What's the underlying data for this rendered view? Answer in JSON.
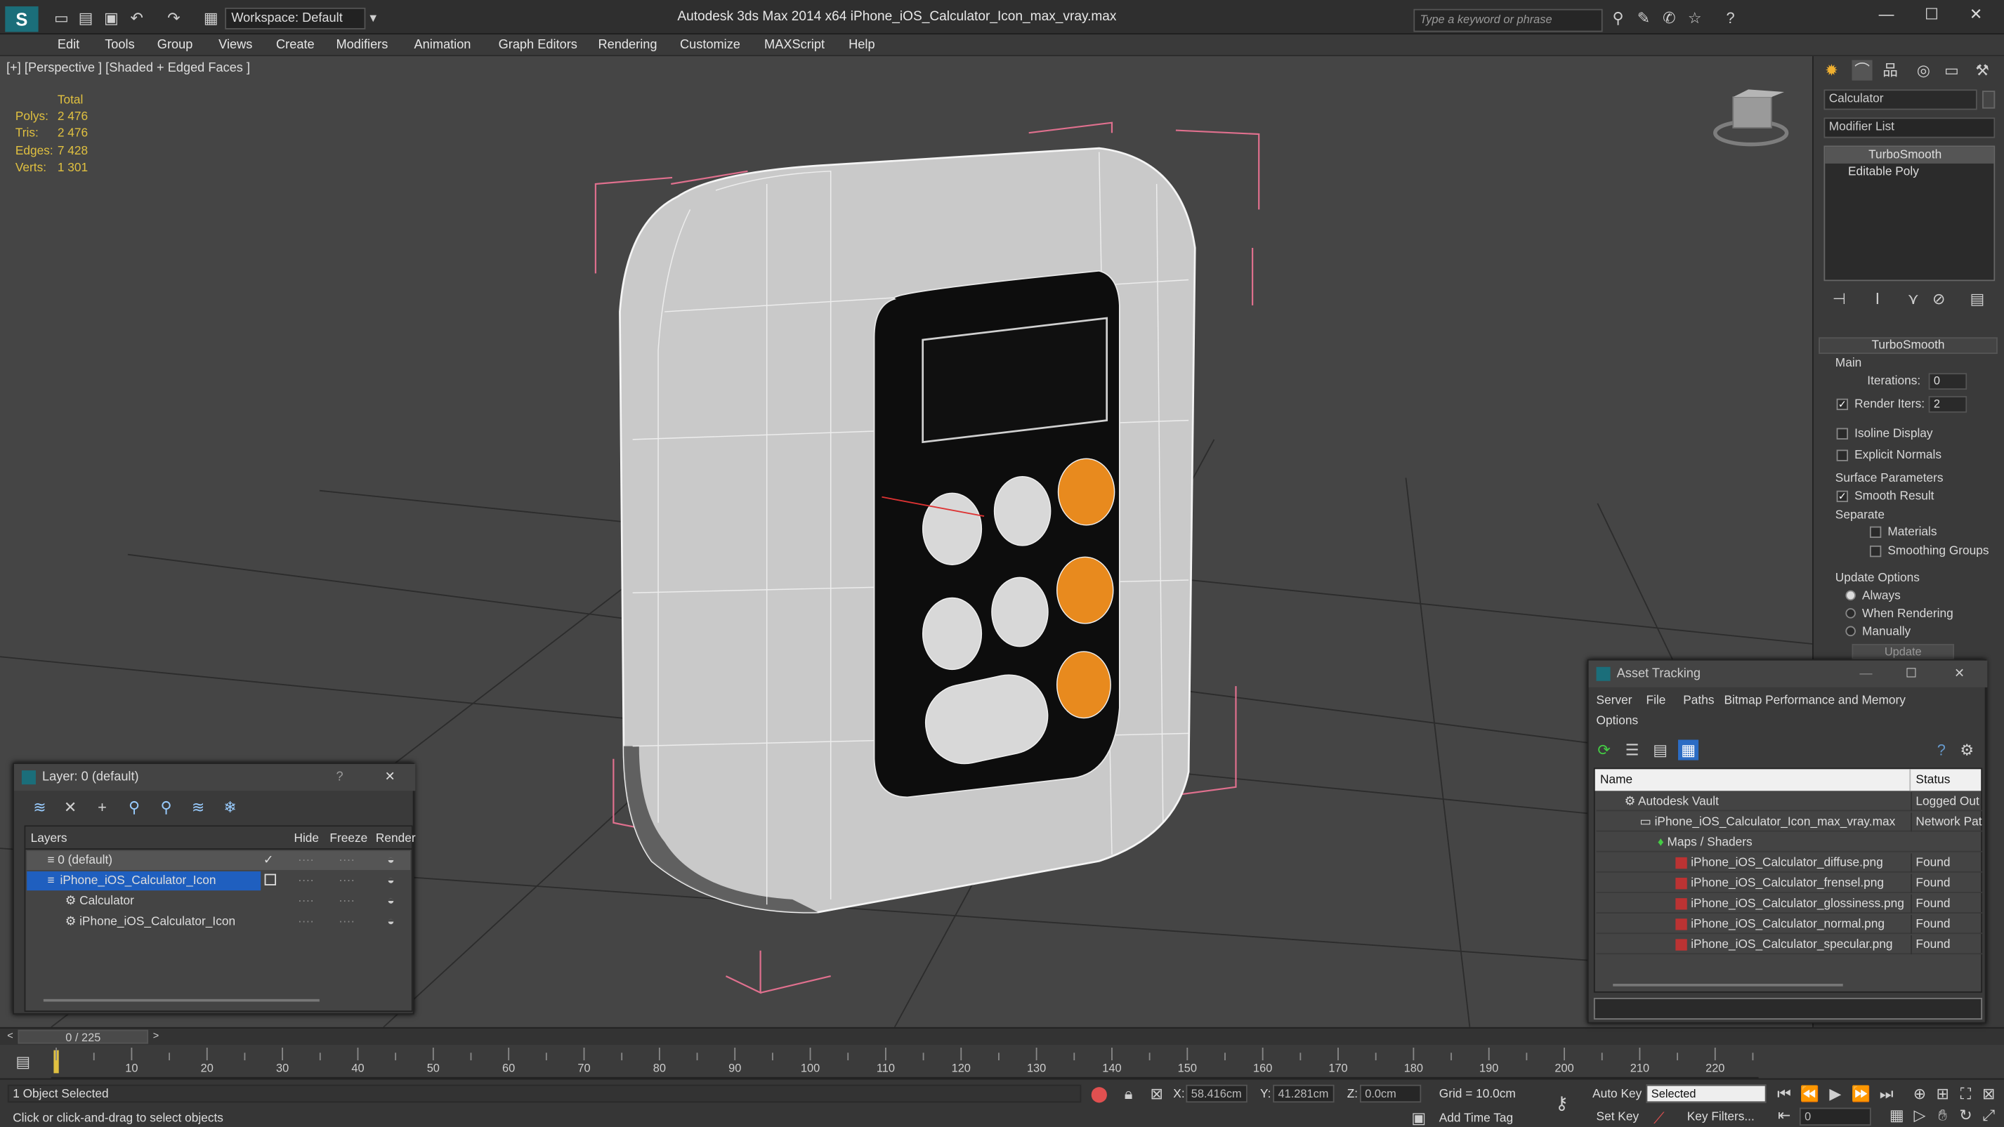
{
  "window": {
    "title": "Autodesk 3ds Max  2014 x64     iPhone_iOS_Calculator_Icon_max_vray.max",
    "workspace": "Workspace: Default",
    "search_placeholder": "Type a keyword or phrase"
  },
  "menu": [
    "Edit",
    "Tools",
    "Group",
    "Views",
    "Create",
    "Modifiers",
    "Animation",
    "Graph Editors",
    "Rendering",
    "Customize",
    "MAXScript",
    "Help"
  ],
  "viewport": {
    "label": "[+] [Perspective ] [Shaded + Edged Faces ]",
    "stats": {
      "header": "Total",
      "rows": [
        {
          "label": "Polys:",
          "value": "2 476"
        },
        {
          "label": "Tris:",
          "value": "2 476"
        },
        {
          "label": "Edges:",
          "value": "7 428"
        },
        {
          "label": "Verts:",
          "value": "1 301"
        }
      ]
    }
  },
  "command_panel": {
    "object_name": "Calculator",
    "modifier_list": "Modifier List",
    "stack": [
      "TurboSmooth",
      "Editable Poly"
    ],
    "rollout_title": "TurboSmooth",
    "main_label": "Main",
    "iterations_label": "Iterations:",
    "iterations_value": "0",
    "render_iters_label": "Render Iters:",
    "render_iters_value": "2",
    "isoline": "Isoline Display",
    "explicit_normals": "Explicit Normals",
    "surface_params": "Surface Parameters",
    "smooth_result": "Smooth Result",
    "separate": "Separate",
    "materials": "Materials",
    "smoothing_groups": "Smoothing Groups",
    "update_options": "Update Options",
    "always": "Always",
    "when_rendering": "When Rendering",
    "manually": "Manually",
    "update_button": "Update"
  },
  "layer_dialog": {
    "title": "Layer: 0 (default)",
    "help": "?",
    "columns": [
      "Layers",
      "Hide",
      "Freeze",
      "Render"
    ],
    "rows": [
      {
        "name": "0 (default)"
      },
      {
        "name": "iPhone_iOS_Calculator_Icon"
      },
      {
        "name": "Calculator"
      },
      {
        "name": "iPhone_iOS_Calculator_Icon"
      }
    ]
  },
  "asset_dialog": {
    "title": "Asset Tracking",
    "menu": [
      "Server",
      "File",
      "Paths",
      "Bitmap Performance and Memory",
      "Options"
    ],
    "columns": [
      "Name",
      "Status"
    ],
    "rows": [
      {
        "name": "Autodesk Vault",
        "status": "Logged Out ..."
      },
      {
        "name": "iPhone_iOS_Calculator_Icon_max_vray.max",
        "status": "Network Path"
      },
      {
        "name": "Maps / Shaders",
        "status": ""
      },
      {
        "name": "iPhone_iOS_Calculator_diffuse.png",
        "status": "Found"
      },
      {
        "name": "iPhone_iOS_Calculator_frensel.png",
        "status": "Found"
      },
      {
        "name": "iPhone_iOS_Calculator_glossiness.png",
        "status": "Found"
      },
      {
        "name": "iPhone_iOS_Calculator_normal.png",
        "status": "Found"
      },
      {
        "name": "iPhone_iOS_Calculator_specular.png",
        "status": "Found"
      }
    ]
  },
  "timeline": {
    "frame": "0 / 225",
    "ticks": [
      "10",
      "20",
      "30",
      "40",
      "50",
      "60",
      "70",
      "80",
      "90",
      "100",
      "110",
      "120",
      "130",
      "140",
      "150",
      "160",
      "170",
      "180",
      "190",
      "200",
      "210",
      "220"
    ]
  },
  "status": {
    "selection": "1 Object Selected",
    "prompt": "Click or click-and-drag to select objects",
    "x_label": "X:",
    "x_value": "58.416cm",
    "y_label": "Y:",
    "y_value": "41.281cm",
    "z_label": "Z:",
    "z_value": "0.0cm",
    "grid": "Grid = 10.0cm",
    "add_time_tag": "Add Time Tag",
    "auto_key": "Auto Key",
    "set_key": "Set Key",
    "selected": "Selected",
    "key_filters": "Key Filters...",
    "frame_field": "0"
  },
  "colors": {
    "accent_orange": "#e88a1e",
    "selection_blue": "#1f5fbf",
    "stats_yellow": "#e0c040"
  }
}
